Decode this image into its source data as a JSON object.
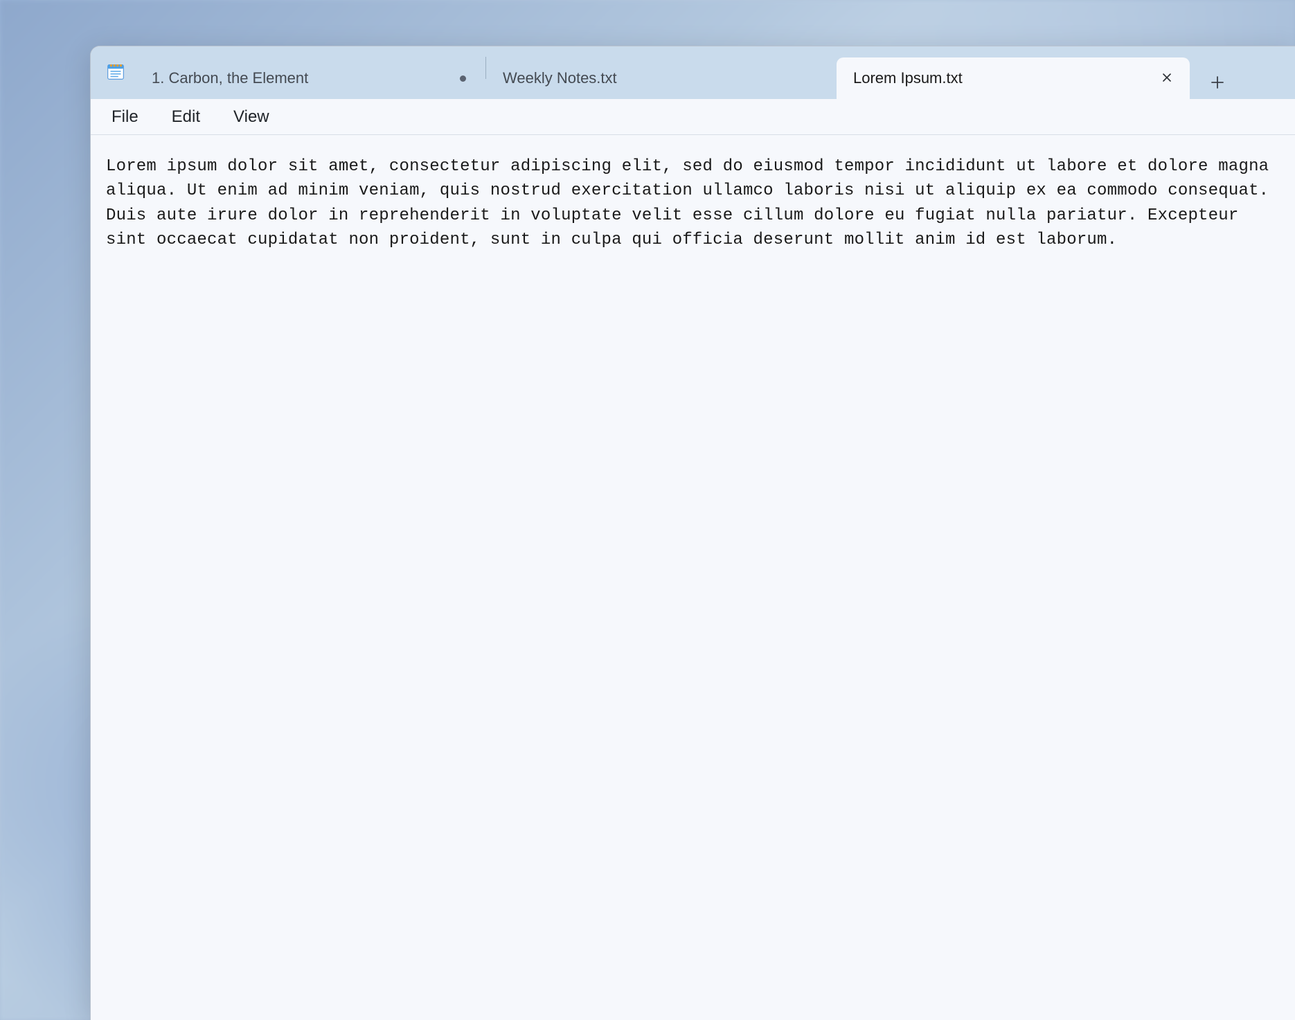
{
  "app": {
    "name": "Notepad"
  },
  "tabs": [
    {
      "label": "1. Carbon, the Element",
      "unsaved": true,
      "active": false
    },
    {
      "label": "Weekly Notes.txt",
      "unsaved": false,
      "active": false
    },
    {
      "label": "Lorem Ipsum.txt",
      "unsaved": false,
      "active": true
    }
  ],
  "menu": {
    "file": "File",
    "edit": "Edit",
    "view": "View"
  },
  "editor": {
    "content": "Lorem ipsum dolor sit amet, consectetur adipiscing elit, sed do eiusmod tempor incididunt ut labore et dolore magna aliqua. Ut enim ad minim veniam, quis nostrud exercitation ullamco laboris nisi ut aliquip ex ea commodo consequat. Duis aute irure dolor in reprehenderit in voluptate velit esse cillum dolore eu fugiat nulla pariatur. Excepteur sint occaecat cupidatat non proident, sunt in culpa qui officia deserunt mollit anim id est laborum."
  },
  "icons": {
    "close": "close-icon",
    "plus": "plus-icon",
    "unsaved": "unsaved-dot-icon",
    "app": "notepad-icon"
  }
}
